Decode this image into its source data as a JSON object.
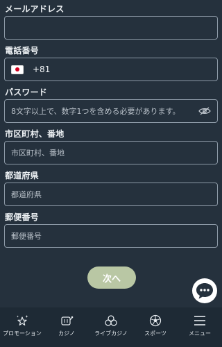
{
  "form": {
    "email_label": "メールアドレス",
    "email_value": "",
    "phone_label": "電話番号",
    "phone_dial_code": "+81",
    "password_label": "パスワード",
    "password_placeholder": "8文字以上で、数字1つを含める必要があります。",
    "address_label": "市区町村、番地",
    "address_placeholder": "市区町村、番地",
    "prefecture_label": "都道府県",
    "prefecture_placeholder": "都道府県",
    "postal_label": "郵便番号",
    "postal_placeholder": "郵便番号"
  },
  "next_button": {
    "label": "次へ"
  },
  "colors": {
    "background": "#25313d",
    "field_border": "#8c99a6",
    "next_button": "#b9c7a4",
    "navbar": "#1e2a35"
  },
  "nav": {
    "items": [
      {
        "label": "プロモーション",
        "icon": "stars-icon"
      },
      {
        "label": "カジノ",
        "icon": "slot-machine-icon"
      },
      {
        "label": "ライブカジノ",
        "icon": "poker-chips-icon"
      },
      {
        "label": "スポーツ",
        "icon": "soccer-ball-icon"
      },
      {
        "label": "メニュー",
        "icon": "hamburger-menu-icon"
      }
    ]
  }
}
